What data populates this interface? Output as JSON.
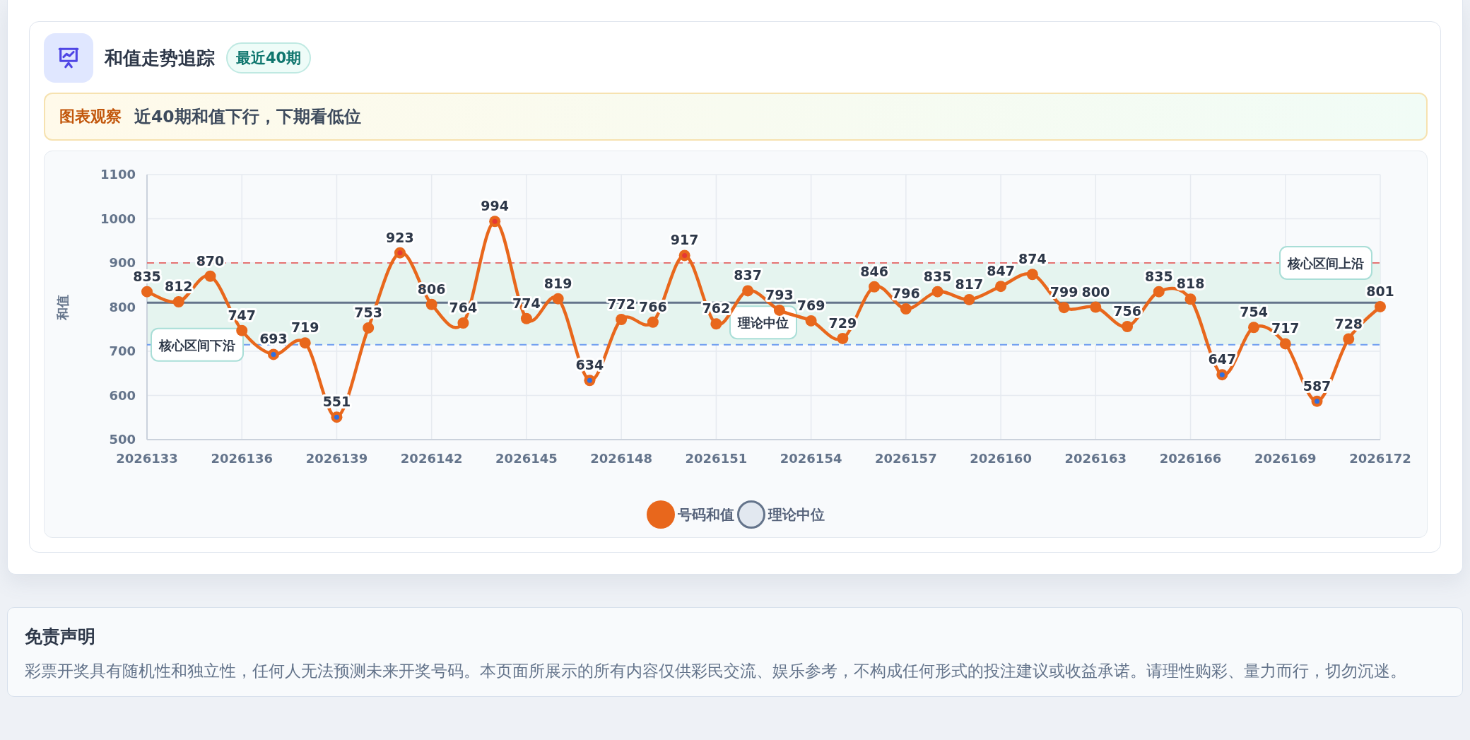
{
  "header": {
    "title": "和值走势追踪",
    "badge": "最近40期"
  },
  "insight": {
    "label": "图表观察",
    "text": "近40期和值下行，下期看低位"
  },
  "chart_data": {
    "type": "line",
    "ylabel": "和值",
    "grid": true,
    "x": [
      2026133,
      2026134,
      2026135,
      2026136,
      2026137,
      2026138,
      2026139,
      2026140,
      2026141,
      2026142,
      2026143,
      2026144,
      2026145,
      2026146,
      2026147,
      2026148,
      2026149,
      2026150,
      2026151,
      2026152,
      2026153,
      2026154,
      2026155,
      2026156,
      2026157,
      2026158,
      2026159,
      2026160,
      2026161,
      2026162,
      2026163,
      2026164,
      2026165,
      2026166,
      2026167,
      2026168,
      2026169,
      2026170,
      2026171,
      2026172
    ],
    "xticks": [
      2026133,
      2026136,
      2026139,
      2026142,
      2026145,
      2026148,
      2026151,
      2026154,
      2026157,
      2026160,
      2026163,
      2026166,
      2026169,
      2026172
    ],
    "xlim": [
      2026133,
      2026172
    ],
    "ylim": [
      500,
      1100
    ],
    "yticks": [
      500,
      600,
      700,
      800,
      900,
      1000,
      1100
    ],
    "series": [
      {
        "name": "号码和值",
        "color": "#e8671c",
        "marker": "o",
        "values": [
          835,
          812,
          870,
          747,
          693,
          719,
          551,
          753,
          923,
          806,
          764,
          994,
          774,
          819,
          634,
          772,
          766,
          917,
          762,
          837,
          793,
          769,
          729,
          846,
          796,
          835,
          817,
          847,
          874,
          799,
          800,
          756,
          835,
          818,
          647,
          754,
          717,
          587,
          728,
          801
        ]
      }
    ],
    "data_labels": true,
    "ref_lines": [
      {
        "axis": "y",
        "value": 900,
        "label": "核心区间上沿",
        "color": "#e57373"
      },
      {
        "axis": "y",
        "value": 715,
        "label": "核心区间下沿",
        "color": "#6d9cf0"
      },
      {
        "axis": "y",
        "value": 810,
        "label": "理论中位",
        "color": "#64748b"
      }
    ]
  },
  "legend": [
    {
      "label": "理论中位",
      "color": "#64748b"
    }
  ],
  "disclaimer": {
    "title": "免责声明",
    "text": "彩票开奖具有随机性和独立性，任何人无法预测未来开奖号码。本页面所展示的所有内容仅供彩民交流、娱乐参考，不构成任何形式的投注建议或收益承诺。请理性购彩、量力而行，切勿沉迷。"
  }
}
